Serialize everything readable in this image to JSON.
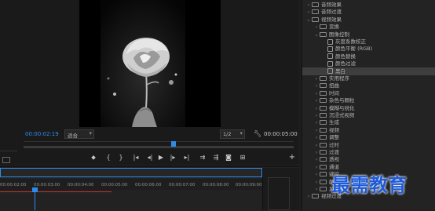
{
  "monitor": {
    "timecode_current": "00:00:02:19",
    "fit_label": "适合",
    "scale_label": "1/2",
    "timecode_total": "00:00:05:00"
  },
  "effects_panel": {
    "items": [
      {
        "label": "音频效果",
        "level": 0,
        "type": "folder",
        "open": false
      },
      {
        "label": "音频过渡",
        "level": 0,
        "type": "folder",
        "open": false
      },
      {
        "label": "视频效果",
        "level": 0,
        "type": "folder",
        "open": true
      },
      {
        "label": "变换",
        "level": 1,
        "type": "folder",
        "open": false
      },
      {
        "label": "图像控制",
        "level": 1,
        "type": "folder",
        "open": true
      },
      {
        "label": "灰度系数校正",
        "level": 2,
        "type": "effect"
      },
      {
        "label": "颜色平衡 (RGB)",
        "level": 2,
        "type": "effect"
      },
      {
        "label": "颜色替换",
        "level": 2,
        "type": "effect"
      },
      {
        "label": "颜色过滤",
        "level": 2,
        "type": "effect"
      },
      {
        "label": "黑白",
        "level": 2,
        "type": "effect",
        "selected": true
      },
      {
        "label": "实用程序",
        "level": 1,
        "type": "folder",
        "open": false
      },
      {
        "label": "扭曲",
        "level": 1,
        "type": "folder",
        "open": false
      },
      {
        "label": "时间",
        "level": 1,
        "type": "folder",
        "open": false
      },
      {
        "label": "杂色与颗粒",
        "level": 1,
        "type": "folder",
        "open": false
      },
      {
        "label": "模糊与锐化",
        "level": 1,
        "type": "folder",
        "open": false
      },
      {
        "label": "沉浸式视频",
        "level": 1,
        "type": "folder",
        "open": false
      },
      {
        "label": "生成",
        "level": 1,
        "type": "folder",
        "open": false
      },
      {
        "label": "视频",
        "level": 1,
        "type": "folder",
        "open": false
      },
      {
        "label": "调整",
        "level": 1,
        "type": "folder",
        "open": false
      },
      {
        "label": "过时",
        "level": 1,
        "type": "folder",
        "open": false
      },
      {
        "label": "过渡",
        "level": 1,
        "type": "folder",
        "open": false
      },
      {
        "label": "透视",
        "level": 1,
        "type": "folder",
        "open": false
      },
      {
        "label": "通道",
        "level": 1,
        "type": "folder",
        "open": false
      },
      {
        "label": "键控",
        "level": 1,
        "type": "folder",
        "open": false
      },
      {
        "label": "颜色校正",
        "level": 1,
        "type": "folder",
        "open": false
      },
      {
        "label": "风格化",
        "level": 1,
        "type": "folder",
        "open": false
      },
      {
        "label": "视频过渡",
        "level": 0,
        "type": "folder",
        "open": false
      }
    ]
  },
  "timeline": {
    "ticks": [
      "00:00:02:00",
      "00:00:03:00",
      "00:00:04:00",
      "00:00:05:00",
      "00:00:06:00",
      "00:00:07:00",
      "00:00:08:00",
      "00:00:09:00"
    ]
  },
  "watermark": "最需教育",
  "colors": {
    "accent": "#2d8ceb",
    "render_bar": "#c3312e",
    "watermark": "#1e5bd9"
  }
}
